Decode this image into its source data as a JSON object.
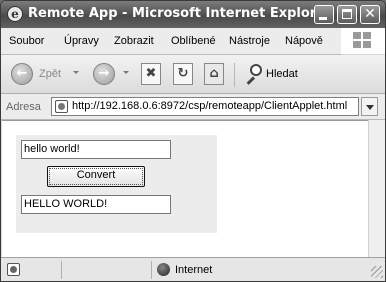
{
  "window": {
    "title": "Remote App - Microsoft Internet Explorer",
    "minimize_icon": "minimize-icon",
    "maximize_icon": "maximize-icon",
    "close_glyph": "✕"
  },
  "menu": {
    "items": [
      "Soubor",
      "Úpravy",
      "Zobrazit",
      "Oblíbené",
      "Nástroje",
      "Nápově"
    ],
    "more": "»"
  },
  "toolbar": {
    "back_label": "Zpět",
    "back_glyph": "←",
    "forward_glyph": "→",
    "stop_glyph": "✖",
    "refresh_glyph": "↻",
    "search_label": "Hledat",
    "more": "»"
  },
  "address": {
    "label": "Adresa",
    "url": "http://192.168.0.6:8972/csp/remoteapp/ClientApplet.html"
  },
  "applet": {
    "input_value": "hello world!",
    "button_label": "Convert",
    "output_value": "HELLO WORLD!"
  },
  "status": {
    "text": "",
    "zone": "Internet"
  },
  "colors": {
    "title_bar": "#555555",
    "applet_bg": "#ececec"
  }
}
